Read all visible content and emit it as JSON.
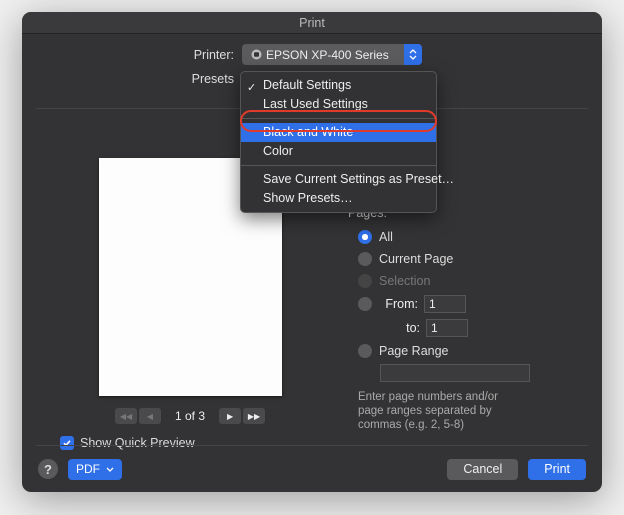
{
  "window": {
    "title": "Print"
  },
  "printer": {
    "label": "Printer:",
    "value": "EPSON XP-400 Series"
  },
  "presets": {
    "label": "Presets",
    "selected": "Default Settings",
    "menu": {
      "items_group1": [
        {
          "label": "Default Settings",
          "checked": true
        },
        {
          "label": "Last Used Settings",
          "checked": false
        }
      ],
      "items_group2": [
        {
          "label": "Black and White",
          "highlighted": true
        },
        {
          "label": "Color"
        }
      ],
      "items_group3": [
        {
          "label": "Save Current Settings as Preset…"
        },
        {
          "label": "Show Presets…"
        }
      ]
    }
  },
  "preview": {
    "pager": "1 of 3",
    "show_quick_preview_label": "Show Quick Preview",
    "show_quick_preview_checked": true
  },
  "pages": {
    "title": "Pages:",
    "options": {
      "all": "All",
      "current": "Current Page",
      "selection": "Selection",
      "from_label": "From:",
      "from_value": "1",
      "to_label": "to:",
      "to_value": "1",
      "page_range": "Page Range"
    },
    "helper": "Enter page numbers and/or page ranges separated by commas (e.g. 2, 5-8)"
  },
  "footer": {
    "pdf_label": "PDF",
    "cancel": "Cancel",
    "print": "Print"
  }
}
